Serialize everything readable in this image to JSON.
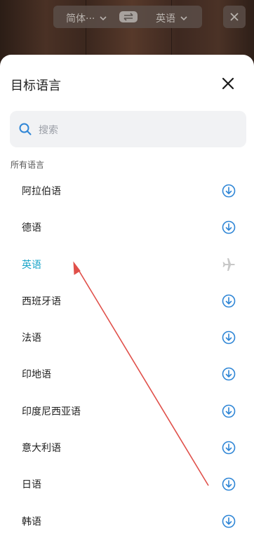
{
  "topbar": {
    "source_lang": "简体···",
    "target_lang": "英语"
  },
  "sheet": {
    "title": "目标语言",
    "search_placeholder": "搜索",
    "section_label": "所有语言",
    "languages": [
      {
        "label": "阿拉伯语",
        "icon": "download-icon",
        "selected": false
      },
      {
        "label": "德语",
        "icon": "download-icon",
        "selected": false
      },
      {
        "label": "英语",
        "icon": "airplane-icon",
        "selected": true
      },
      {
        "label": "西班牙语",
        "icon": "download-icon",
        "selected": false
      },
      {
        "label": "法语",
        "icon": "download-icon",
        "selected": false
      },
      {
        "label": "印地语",
        "icon": "download-icon",
        "selected": false
      },
      {
        "label": "印度尼西亚语",
        "icon": "download-icon",
        "selected": false
      },
      {
        "label": "意大利语",
        "icon": "download-icon",
        "selected": false
      },
      {
        "label": "日语",
        "icon": "download-icon",
        "selected": false
      },
      {
        "label": "韩语",
        "icon": "download-icon",
        "selected": false
      }
    ]
  },
  "colors": {
    "accent": "#1aa5c9",
    "icon_blue": "#2f86d6",
    "airplane_gray": "#c8c8c8",
    "annotation_arrow": "#e0504a"
  }
}
